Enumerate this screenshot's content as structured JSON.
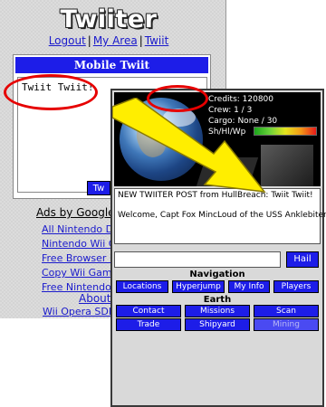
{
  "left_page": {
    "logo_text": "Twiiter",
    "top_links": [
      "Logout",
      "My Area",
      "Twiit"
    ],
    "twiit_box": {
      "header": "Mobile Twiit",
      "textarea_value": "Twiit Twiit!",
      "submit_label": "Tw"
    },
    "ads": {
      "title": "Ads by Google",
      "items": [
        "All Nintendo DS",
        "Nintendo Wii Op",
        "Free Browser D",
        "Copy Wii Games",
        "Free Nintendo"
      ]
    },
    "about_link": "About T",
    "sdk_link": "Wii Opera SDK"
  },
  "game": {
    "hud": {
      "credits": "Credits: 120800",
      "crew": "Crew: 1 / 3",
      "cargo": "Cargo: None / 30",
      "shield_label": "Sh/Hl/Wp"
    },
    "messages": [
      "NEW TWIITER POST from HullBreach: Twiit Twiit!",
      "Welcome, Capt Fox MincLoud of the USS Anklebiter!"
    ],
    "command": {
      "input_value": "",
      "hail_label": "Hail"
    },
    "navigation": {
      "title": "Navigation",
      "buttons": [
        "Locations",
        "Hyperjump",
        "My Info",
        "Players"
      ]
    },
    "earth": {
      "title": "Earth",
      "buttons": [
        "Contact",
        "Missions",
        "Scan",
        "Trade",
        "Shipyard",
        "Mining"
      ]
    }
  },
  "colors": {
    "accent": "#1d1de8",
    "highlight": "#e60000",
    "arrow": "#ffee00"
  },
  "icons": {
    "arrow": "arrow-icon",
    "planet": "planet-icon"
  }
}
